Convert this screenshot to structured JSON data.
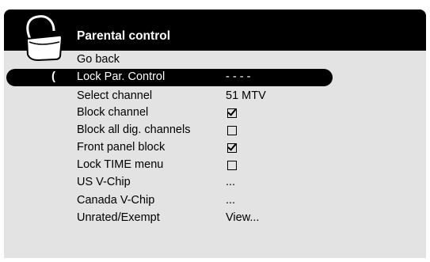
{
  "menu": {
    "title": "Parental control",
    "cursor": "(",
    "items": [
      {
        "label": "Go back",
        "value": ""
      },
      {
        "label": "Lock Par. Control",
        "value": "- - - -",
        "selected": true
      },
      {
        "label": "Select channel",
        "value": "51 MTV"
      },
      {
        "label": "Block channel",
        "checkbox": "checked"
      },
      {
        "label": "Block all dig. channels",
        "checkbox": "unchecked"
      },
      {
        "label": "Front panel block",
        "checkbox": "checked"
      },
      {
        "label": "Lock TIME menu",
        "checkbox": "unchecked"
      },
      {
        "label": "US V-Chip",
        "value": "..."
      },
      {
        "label": "Canada V-Chip",
        "value": "..."
      },
      {
        "label": "Unrated/Exempt",
        "value": "View..."
      }
    ]
  },
  "icons": {
    "lock": "padlock-icon"
  },
  "colors": {
    "header": "#000000",
    "body": "#e3e3e3",
    "selection": "#000000",
    "text": "#000000",
    "selected_text": "#ffffff"
  }
}
